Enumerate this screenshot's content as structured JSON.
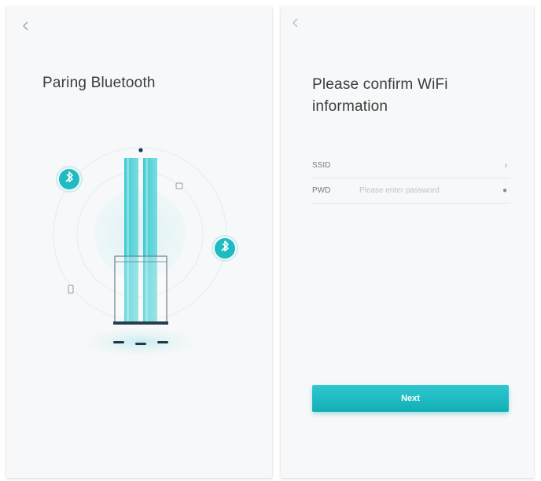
{
  "left_screen": {
    "title": "Paring Bluetooth"
  },
  "right_screen": {
    "title": "Please confirm WiFi information",
    "ssid": {
      "label": "SSID",
      "value": "",
      "trailing": "›"
    },
    "pwd": {
      "label": "PWD",
      "placeholder": "Please enter password",
      "trailing": "●"
    },
    "next_label": "Next"
  },
  "colors": {
    "accent": "#1fbac2",
    "accent_light": "#bfe8ec",
    "background": "#f7f8f9",
    "title_text": "#3c3c3c"
  },
  "icons": {
    "back": "chevron-left-icon",
    "bluetooth": "bluetooth-icon",
    "device": "purifier-device-icon",
    "phone": "phone-icon",
    "info": "info-icon"
  }
}
